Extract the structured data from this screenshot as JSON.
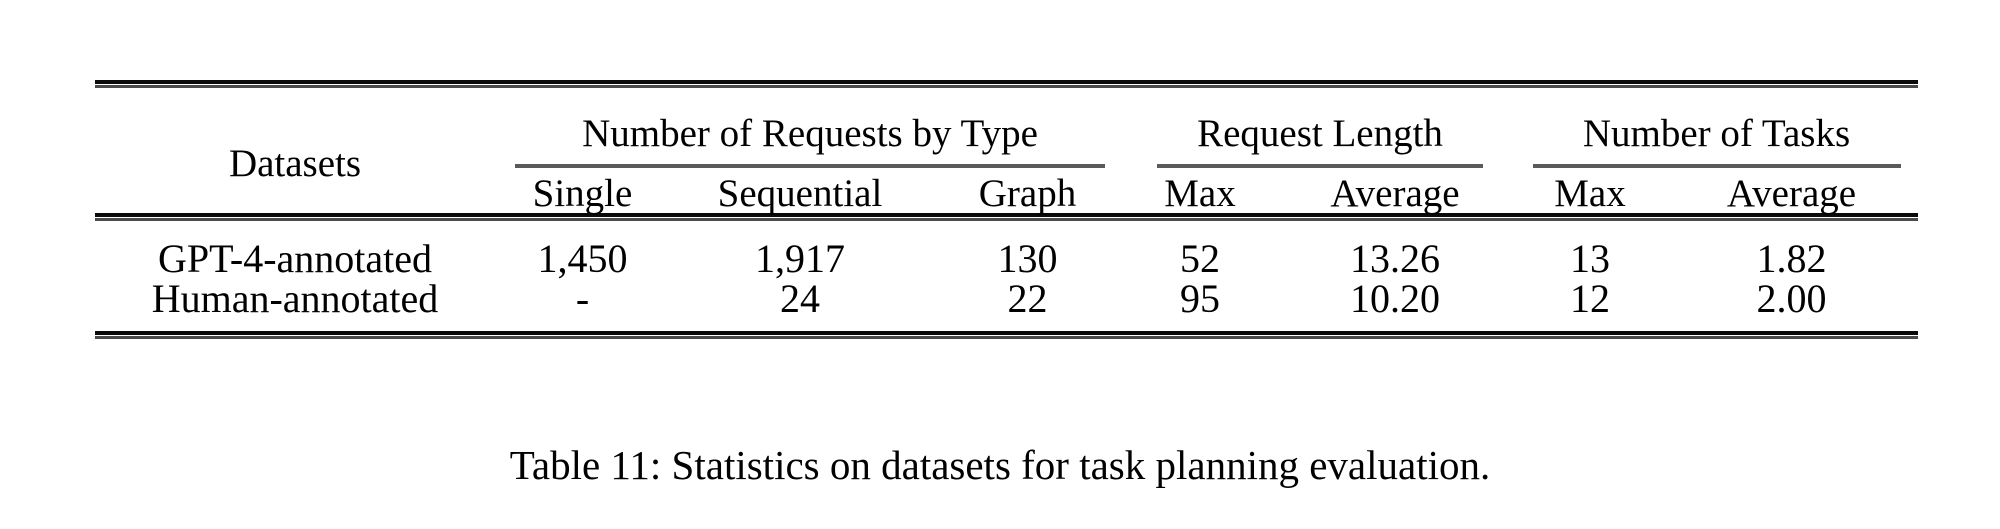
{
  "table": {
    "number": "Table 11",
    "caption": "Table 11: Statistics on datasets for task planning evaluation.",
    "row_header_label": "Datasets",
    "column_groups": [
      {
        "label": "Number of Requests by Type",
        "span": 3
      },
      {
        "label": "Request Length",
        "span": 2
      },
      {
        "label": "Number of Tasks",
        "span": 2
      }
    ],
    "columns": [
      "Datasets",
      "Single",
      "Sequential",
      "Graph",
      "Max",
      "Average",
      "Max",
      "Average"
    ],
    "rows": [
      {
        "name": "GPT-4-annotated",
        "single": "1,450",
        "sequential": "1,917",
        "graph": "130",
        "req_len_max": "52",
        "req_len_avg": "13.26",
        "tasks_max": "13",
        "tasks_avg": "1.82"
      },
      {
        "name": "Human-annotated",
        "single": "-",
        "sequential": "24",
        "graph": "22",
        "req_len_max": "95",
        "req_len_avg": "10.20",
        "tasks_max": "12",
        "tasks_avg": "2.00"
      }
    ]
  },
  "style": {
    "text_color": "#000000",
    "background_color": "#ffffff",
    "rule_color": "#0a0a0a",
    "group_rule_color": "#5a5a5a"
  }
}
